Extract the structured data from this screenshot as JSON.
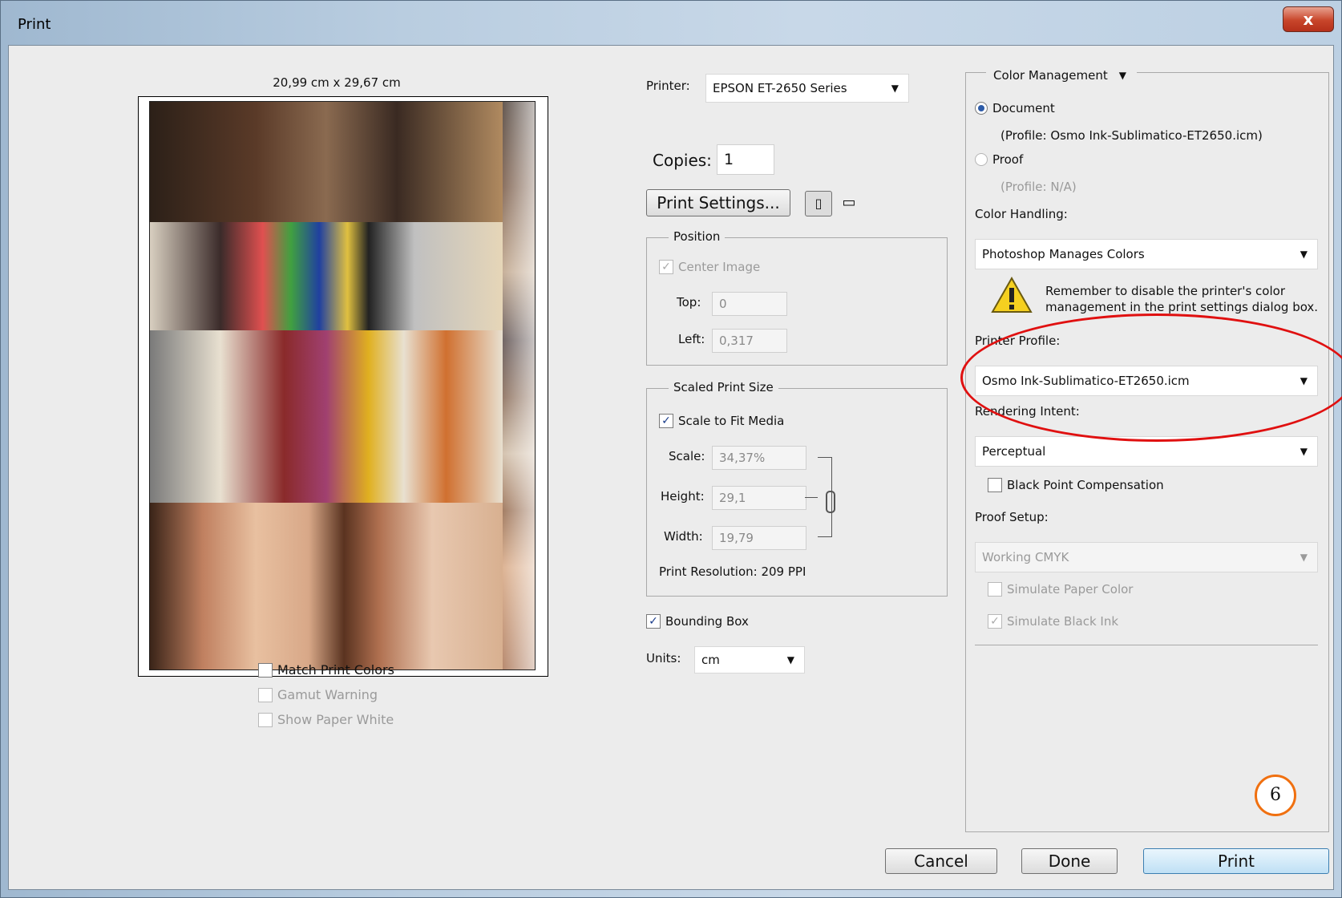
{
  "window": {
    "title": "Print",
    "close_glyph": "x"
  },
  "preview": {
    "paper_size": "20,99 cm x 29,67 cm",
    "options": [
      {
        "label": "Match Print Colors",
        "checked": false,
        "enabled": true
      },
      {
        "label": "Gamut Warning",
        "checked": false,
        "enabled": false
      },
      {
        "label": "Show Paper White",
        "checked": false,
        "enabled": false
      }
    ]
  },
  "printer": {
    "label": "Printer:",
    "value": "EPSON ET-2650 Series"
  },
  "copies": {
    "label": "Copies:",
    "value": "1"
  },
  "print_settings_button": "Print Settings...",
  "orientation_icons": [
    "portrait-orientation-icon",
    "landscape-orientation-icon"
  ],
  "position": {
    "title": "Position",
    "center_image": {
      "label": "Center Image",
      "checked": true,
      "enabled": false
    },
    "top": {
      "label": "Top:",
      "value": "0"
    },
    "left": {
      "label": "Left:",
      "value": "0,317"
    }
  },
  "scaled": {
    "title": "Scaled Print Size",
    "scale_to_fit": {
      "label": "Scale to Fit Media",
      "checked": true
    },
    "scale": {
      "label": "Scale:",
      "value": "34,37%"
    },
    "height": {
      "label": "Height:",
      "value": "29,1"
    },
    "width": {
      "label": "Width:",
      "value": "19,79"
    },
    "resolution": "Print Resolution: 209 PPI"
  },
  "bounding_box": {
    "label": "Bounding Box",
    "checked": true
  },
  "units": {
    "label": "Units:",
    "value": "cm"
  },
  "color_management": {
    "section_dropdown": "Color Management",
    "document": {
      "label": "Document",
      "selected": true,
      "profile": "(Profile: Osmo Ink-Sublimatico-ET2650.icm)"
    },
    "proof": {
      "label": "Proof",
      "selected": false,
      "profile": "(Profile: N/A)"
    },
    "color_handling_label": "Color Handling:",
    "color_handling_value": "Photoshop Manages Colors",
    "warning_line1": "Remember to disable the printer's color",
    "warning_line2": "management in the print settings dialog box.",
    "printer_profile_label": "Printer Profile:",
    "printer_profile_value": "Osmo Ink-Sublimatico-ET2650.icm",
    "rendering_intent_label": "Rendering Intent:",
    "rendering_intent_value": "Perceptual",
    "black_point": {
      "label": "Black Point Compensation",
      "checked": false
    },
    "proof_setup_label": "Proof Setup:",
    "proof_setup_value": "Working CMYK",
    "simulate_paper": {
      "label": "Simulate Paper Color",
      "checked": false,
      "enabled": false
    },
    "simulate_black": {
      "label": "Simulate Black Ink",
      "checked": true,
      "enabled": false
    }
  },
  "buttons": {
    "cancel": "Cancel",
    "done": "Done",
    "print": "Print"
  },
  "annotation": {
    "step_number": "6",
    "ellipse_color": "#e01010",
    "badge_color": "#f07010"
  }
}
